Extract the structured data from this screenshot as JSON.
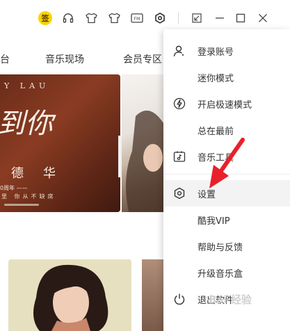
{
  "titlebar": {
    "sign_badge": "签",
    "icons": [
      "headphones-icon",
      "skin-shirt-icon",
      "fm-icon",
      "settings-icon",
      "mini-mode-icon",
      "minimize-icon",
      "maximize-icon",
      "close-icon"
    ]
  },
  "nav": {
    "items": [
      "台",
      "音乐现场",
      "会员专区"
    ]
  },
  "hero": {
    "lau_text": "Y LAU",
    "script_text": "到你",
    "name_text": "德华",
    "line_text": "0周年 ——",
    "sub_text": "里  你从不缺席"
  },
  "menu": {
    "items": [
      {
        "label": "登录账号",
        "icon": "user-icon"
      },
      {
        "label": "迷你模式",
        "icon": ""
      },
      {
        "label": "开启极速模式",
        "icon": "lightning-icon"
      },
      {
        "label": "总在最前",
        "icon": ""
      },
      {
        "label": "音乐工具",
        "icon": "music-tool-icon"
      },
      {
        "label": "设置",
        "icon": "settings-icon"
      },
      {
        "label": "酷我VIP",
        "icon": ""
      },
      {
        "label": "帮助与反馈",
        "icon": ""
      },
      {
        "label": "升级音乐盒",
        "icon": ""
      },
      {
        "label": "退出软件",
        "icon": "power-icon"
      }
    ]
  },
  "watermark": "Bai 经验",
  "colors": {
    "accent_yellow": "#f8d400",
    "arrow_red": "#e8202a"
  }
}
